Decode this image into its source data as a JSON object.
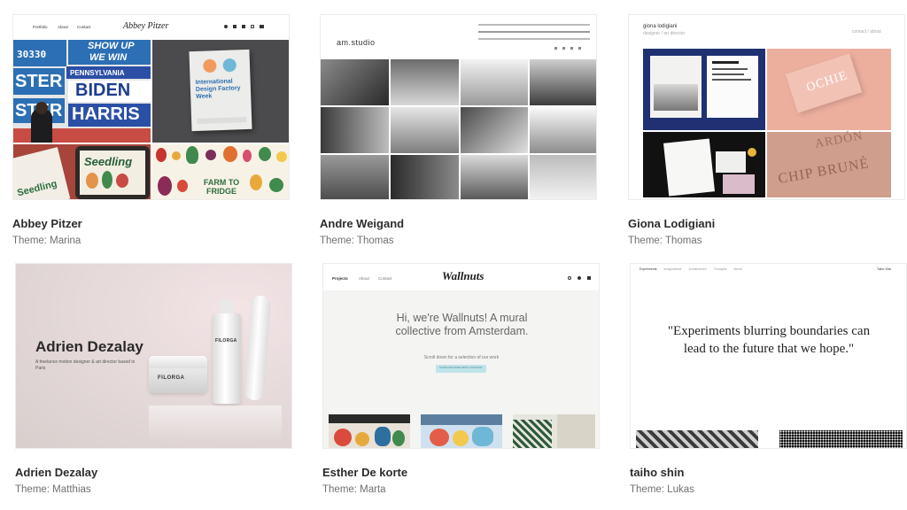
{
  "cards": [
    {
      "name": "Abbey Pitzer",
      "theme": "Theme: Marina",
      "preview": {
        "nav": [
          "Portfolio",
          "About",
          "Contact"
        ],
        "logo": "Abbey Pitzer",
        "social_icons": [
          "twitter-icon",
          "behance-icon",
          "linkedin-icon",
          "instagram-icon",
          "mail-icon"
        ],
        "sign_lines": [
          "SHOW UP",
          "WE WIN",
          "PENNSYLVANIA",
          "BIDEN",
          "HARRIS"
        ],
        "sign_number": "30330",
        "book_title": "International Design Factory Week",
        "seedling": "Seedling",
        "farm": "FARM TO FRIDGE"
      }
    },
    {
      "name": "Andre Weigand",
      "theme": "Theme: Thomas",
      "preview": {
        "logo": "am.studio"
      }
    },
    {
      "name": "Giona Lodigiani",
      "theme": "Theme: Thomas",
      "preview": {
        "title": "giona lodigiani",
        "subtitle": "designer / art director",
        "links": "contact / about"
      }
    },
    {
      "name": "Adrien Dezalay",
      "theme": "Theme: Matthias",
      "preview": {
        "title": "Adrien Dezalay",
        "subtitle": "A freelance motion designer & art director based in Paris",
        "brand": "FILORGA"
      }
    },
    {
      "name": "Esther De korte",
      "theme": "Theme: Marta",
      "preview": {
        "nav": [
          "Projects",
          "About",
          "Contact"
        ],
        "logo": "Wallnuts",
        "headline": "Hi, we're Wallnuts! A mural collective from Amsterdam.",
        "scroll_text": "Scroll down for a selection of our work",
        "cta": "DOWNLOAD MORE ABOUT OUR WORK"
      }
    },
    {
      "name": "taiho shin",
      "theme": "Theme: Lukas",
      "preview": {
        "nav": [
          "Experiments",
          "Imaginations",
          "Architectures",
          "Thoughts",
          "About"
        ],
        "corner": "Taiho Shin",
        "quote": "\"Experiments blurring boundaries can lead to the future that we hope.\""
      }
    }
  ],
  "colors": {
    "page_bg": "#ffffff",
    "name_text": "#2c2c2c",
    "theme_text": "#707070",
    "giona_navy": "#203173",
    "giona_pink": "#ecaf9e",
    "wallnuts_button": "#bfe4ea"
  }
}
